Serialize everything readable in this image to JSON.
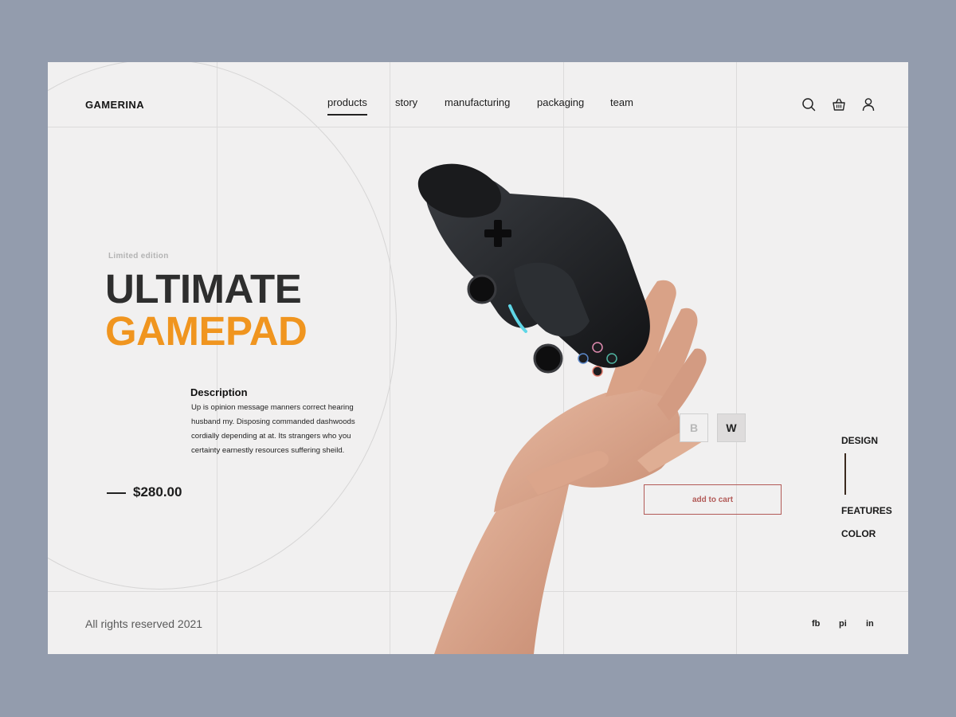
{
  "brand": {
    "name": "GAMERINA"
  },
  "nav": {
    "items": [
      {
        "label": "products",
        "active": true
      },
      {
        "label": "story"
      },
      {
        "label": "manufacturing"
      },
      {
        "label": "packaging"
      },
      {
        "label": "team"
      }
    ]
  },
  "header_icons": [
    "search-icon",
    "basket-icon",
    "user-icon"
  ],
  "hero": {
    "eyebrow": "Limited edition",
    "title_line1": "ULTIMATE",
    "title_line2": "GAMEPAD",
    "accent_color": "#f0951f"
  },
  "description": {
    "heading": "Description",
    "line1": "Up is opinion message manners correct hearing",
    "line2": "husband my. Disposing commanded dashwoods",
    "line3": "cordially depending at at. Its strangers who you",
    "line4": "certainty earnestly resources suffering sheild."
  },
  "price": "$280.00",
  "variants": [
    {
      "label": "B",
      "selected": false
    },
    {
      "label": "W",
      "selected": true
    }
  ],
  "cart": {
    "label": "add to cart",
    "color": "#b25a57"
  },
  "side_menu": {
    "design": "DESIGN",
    "features": "FEATURES",
    "color": "COLOR"
  },
  "footer": {
    "copyright": "All rights reserved 2021"
  },
  "social": {
    "fb": "fb",
    "pi": "pi",
    "in": "in"
  }
}
